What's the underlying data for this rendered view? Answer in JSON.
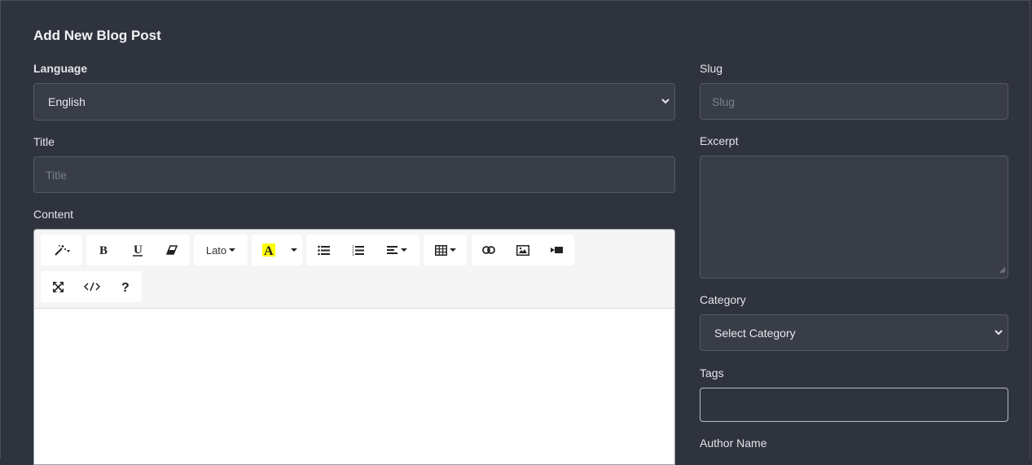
{
  "page": {
    "heading": "Add New Blog Post"
  },
  "form": {
    "language": {
      "label": "Language",
      "value": "English"
    },
    "title": {
      "label": "Title",
      "placeholder": "Title"
    },
    "content": {
      "label": "Content"
    },
    "slug": {
      "label": "Slug",
      "placeholder": "Slug"
    },
    "excerpt": {
      "label": "Excerpt",
      "value": ""
    },
    "category": {
      "label": "Category",
      "value": "Select Category"
    },
    "tags": {
      "label": "Tags",
      "value": ""
    },
    "author": {
      "label": "Author Name"
    }
  },
  "editor": {
    "font_name": "Lato",
    "toolbar_row1": [
      "magic-icon",
      "bold-icon",
      "underline-icon",
      "eraser-icon",
      "font-name",
      "highlight-color-icon",
      "color-dropdown",
      "unordered-list-icon",
      "ordered-list-icon",
      "align-icon",
      "table-icon",
      "link-icon",
      "image-icon",
      "video-icon"
    ],
    "toolbar_row2": [
      "fullscreen-icon",
      "code-view-icon",
      "help-icon"
    ],
    "highlight_color": "#ffff00"
  }
}
